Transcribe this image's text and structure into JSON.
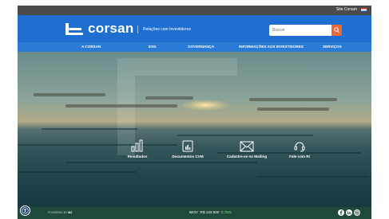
{
  "topbar": {
    "site_link": "Site Corsan"
  },
  "header": {
    "brand": "corsan",
    "tagline": "Relações com Investidores",
    "search_placeholder": "Buscar"
  },
  "nav": {
    "items": [
      {
        "label": "A CORSAN"
      },
      {
        "label": "ESG"
      },
      {
        "label": "GOVERNANÇA"
      },
      {
        "label": "INFORMAÇÕES AOS INVESTIDORES"
      },
      {
        "label": "SERVIÇOS"
      }
    ]
  },
  "quick_links": [
    {
      "label": "Resultados",
      "icon": "bar-chart-icon"
    },
    {
      "label": "Documentos CVM",
      "icon": "document-chart-icon"
    },
    {
      "label": "Cadastre-se no Mailing",
      "icon": "envelope-icon"
    },
    {
      "label": "Fale com RI",
      "icon": "headset-icon"
    }
  ],
  "footer": {
    "powered_by": "POWERED BY",
    "powered_brand": "MZ",
    "ticker": {
      "label": "IBOV",
      "value": "R$ 133.500",
      "variation": "0,75%"
    },
    "socials": [
      "facebook-icon",
      "linkedin-icon",
      "instagram-icon"
    ]
  },
  "colors": {
    "header": "#1e6fd0",
    "nav": "#2a7bd6",
    "search_button": "#e8693a",
    "footer": "#1f4a3b",
    "positive": "#7ee37e"
  }
}
